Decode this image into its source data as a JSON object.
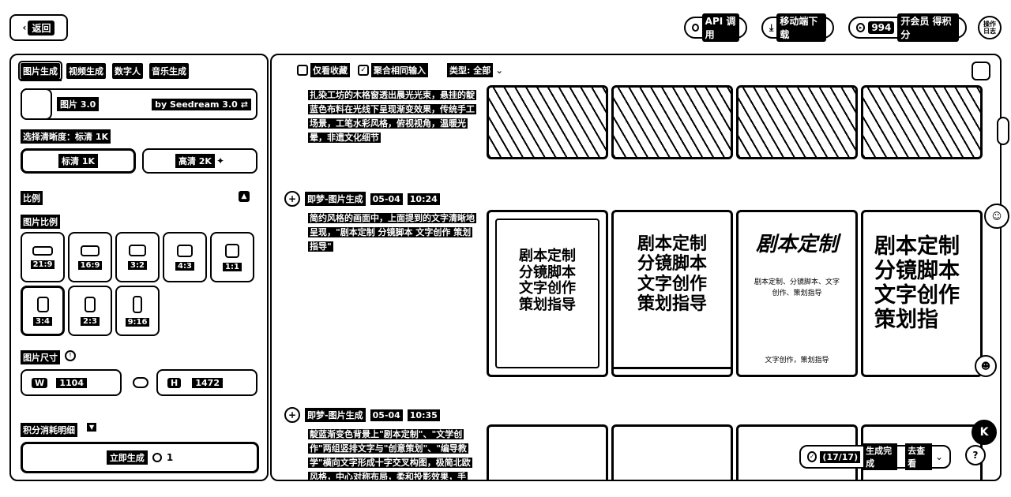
{
  "header": {
    "back_label": "返回",
    "api_label": "API 调用",
    "mobile_label": "移动端下载",
    "points": "994",
    "vip_label": "开会员 得积分",
    "avatar_text": "操作 日志"
  },
  "left": {
    "tabs": [
      "图片生成",
      "视频生成",
      "数字人",
      "音乐生成"
    ],
    "model": {
      "name": "图片 3.0",
      "by": "by Seedream 3.0"
    },
    "quality_label": "选择清晰度：标清 1K",
    "quality_options": [
      "标清 1K",
      "高清 2K"
    ],
    "ratio_section": "比例",
    "ratio_sub": "图片比例",
    "ratios": [
      "21:9",
      "16:9",
      "3:2",
      "4:3",
      "1:1",
      "3:4",
      "2:3",
      "9:16"
    ],
    "selected_ratio": "3:4",
    "size_label": "图片尺寸",
    "width_key": "W",
    "width": "1104",
    "height_key": "H",
    "height": "1472",
    "points_detail": "积分消耗明细",
    "generate_label": "立即生成",
    "generate_cost": "1"
  },
  "right": {
    "filter_favorites": "仅看收藏",
    "filter_merge": "聚合相同输入",
    "filter_type": "类型: 全部",
    "rows": [
      {
        "prompt": "扎染工坊的木格窗透出晨光光束，悬挂的靛蓝色布料在光线下呈现渐变效果，传统手工场景，工笔水彩风格，俯视视角，温暖光晕，非遗文化细节"
      },
      {
        "source": "即梦-图片生成",
        "date": "05-04",
        "time": "10:24",
        "prompt": "简约风格的画面中，上面提到的文字清晰地呈现，\"剧本定制 分镜脚本 文字创作 策划指导\"",
        "poster_lines": [
          "剧本定制",
          "分镜脚本",
          "文字创作",
          "策划指导"
        ],
        "poster3_title": "剧本定制",
        "poster3_sub": "剧本定制、分镜脚本、文字创作、策划指导",
        "poster3_foot": "文字创作，策划指导",
        "poster4_lines": [
          "剧本定制",
          "分镜脚本",
          "文字创作",
          "策划指"
        ]
      },
      {
        "source": "即梦-图片生成",
        "date": "05-04",
        "time": "10:35",
        "prompt": "靛蓝渐变色背景上\"剧本定制\"、\"文学创作\"两组竖排文字与\"创意策划\"、\"编导教学\"横向文字形成十字交叉构图，极简北欧风格，中心对称布局，柔和投影效果，手"
      }
    ],
    "status_count": "(17/17)",
    "status_text": "生成完成",
    "status_link": "去查看"
  }
}
